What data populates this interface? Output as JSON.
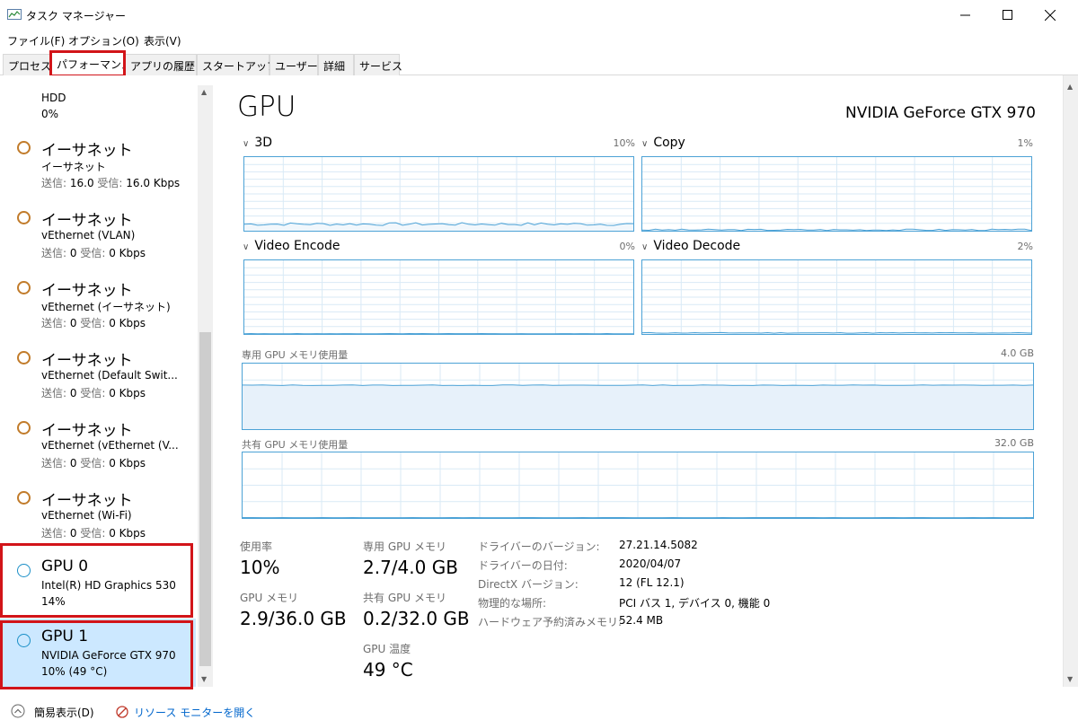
{
  "window": {
    "title": "タスク マネージャー",
    "controls": {
      "minimize": "minimize",
      "maximize": "maximize",
      "close": "close"
    }
  },
  "menu": [
    "ファイル(F)",
    "オプション(O)",
    "表示(V)"
  ],
  "tabs": [
    {
      "label": "プロセス",
      "active": false
    },
    {
      "label": "パフォーマンス",
      "active": true
    },
    {
      "label": "アプリの履歴",
      "active": false
    },
    {
      "label": "スタートアップ",
      "active": false
    },
    {
      "label": "ユーザー",
      "active": false
    },
    {
      "label": "詳細",
      "active": false
    },
    {
      "label": "サービス",
      "active": false
    }
  ],
  "sidebar": {
    "partial_item": {
      "title": "HDD",
      "value": "0%"
    },
    "items": [
      {
        "title": "イーサネット",
        "subtitle": "イーサネット",
        "send_label": "送信:",
        "send": "16.0",
        "recv_label": "受信:",
        "recv": "16.0 Kbps",
        "type": "ethernet"
      },
      {
        "title": "イーサネット",
        "subtitle": "vEthernet (VLAN)",
        "send_label": "送信:",
        "send": "0",
        "recv_label": "受信:",
        "recv": "0 Kbps",
        "type": "ethernet"
      },
      {
        "title": "イーサネット",
        "subtitle": "vEthernet (イーサネット)",
        "send_label": "送信:",
        "send": "0",
        "recv_label": "受信:",
        "recv": "0 Kbps",
        "type": "ethernet"
      },
      {
        "title": "イーサネット",
        "subtitle": "vEthernet (Default Swit...",
        "send_label": "送信:",
        "send": "0",
        "recv_label": "受信:",
        "recv": "0 Kbps",
        "type": "ethernet"
      },
      {
        "title": "イーサネット",
        "subtitle": "vEthernet (vEthernet (V...",
        "send_label": "送信:",
        "send": "0",
        "recv_label": "受信:",
        "recv": "0 Kbps",
        "type": "ethernet"
      },
      {
        "title": "イーサネット",
        "subtitle": "vEthernet (Wi-Fi)",
        "send_label": "送信:",
        "send": "0",
        "recv_label": "受信:",
        "recv": "0 Kbps",
        "type": "ethernet"
      },
      {
        "title": "GPU 0",
        "subtitle": "Intel(R) HD Graphics 530",
        "usage": "14%",
        "type": "gpu"
      },
      {
        "title": "GPU 1",
        "subtitle": "NVIDIA GeForce GTX 970",
        "usage": "10% (49 °C)",
        "type": "gpu",
        "selected": true
      }
    ]
  },
  "main": {
    "title": "GPU",
    "device_name": "NVIDIA GeForce GTX 970",
    "engines": [
      {
        "name": "3D",
        "percent": "10%"
      },
      {
        "name": "Copy",
        "percent": "1%"
      },
      {
        "name": "Video Encode",
        "percent": "0%"
      },
      {
        "name": "Video Decode",
        "percent": "2%"
      }
    ],
    "dedicated_memory": {
      "label": "専用 GPU メモリ使用量",
      "max": "4.0 GB"
    },
    "shared_memory": {
      "label": "共有 GPU メモリ使用量",
      "max": "32.0 GB"
    },
    "stats": {
      "usage_label": "使用率",
      "usage": "10%",
      "dedicated_label": "専用 GPU メモリ",
      "dedicated": "2.7/4.0 GB",
      "gpu_mem_label": "GPU メモリ",
      "gpu_mem": "2.9/36.0 GB",
      "shared_label": "共有 GPU メモリ",
      "shared": "0.2/32.0 GB",
      "temp_label": "GPU 温度",
      "temp": "49 °C"
    },
    "info": [
      {
        "label": "ドライバーのバージョン:",
        "value": "27.21.14.5082"
      },
      {
        "label": "ドライバーの日付:",
        "value": "2020/04/07"
      },
      {
        "label": "DirectX バージョン:",
        "value": "12 (FL 12.1)"
      },
      {
        "label": "物理的な場所:",
        "value": "PCI バス 1, デバイス 0, 機能 0"
      },
      {
        "label": "ハードウェア予約済みメモリ:",
        "value": "52.4 MB"
      }
    ]
  },
  "footer": {
    "simple_view": "簡易表示(D)",
    "resource_monitor": "リソース モニターを開く"
  },
  "colors": {
    "accent": "#4ca2d6",
    "highlight": "#d21419",
    "selected_bg": "#cce8ff",
    "ethernet_ring": "#c17b2a",
    "gpu_ring": "#1a8fc7"
  }
}
